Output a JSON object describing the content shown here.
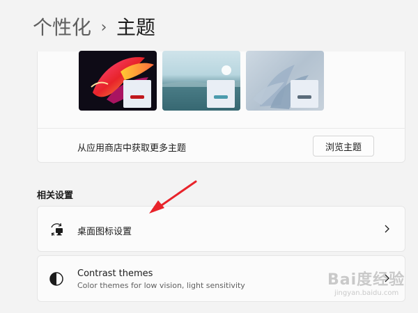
{
  "header": {
    "parent": "个性化",
    "separator": "›",
    "current": "主题"
  },
  "themes": {
    "items": [
      {
        "name": "theme-glow",
        "accent": "#c0181c"
      },
      {
        "name": "theme-captured-motion",
        "accent": "#4b9bad"
      },
      {
        "name": "theme-flow",
        "accent": "#5a6b7a"
      }
    ],
    "store_text": "从应用商店中获取更多主题",
    "browse_label": "浏览主题"
  },
  "related": {
    "section_label": "相关设置",
    "desktop_icons": {
      "title": "桌面图标设置",
      "icon": "desktop-icon-settings-icon"
    },
    "contrast": {
      "title": "Contrast themes",
      "subtitle": "Color themes for low vision, light sensitivity",
      "icon": "contrast-icon"
    }
  },
  "annotation": {
    "color": "#e8232a"
  },
  "watermark": {
    "logo": "Bai度经验",
    "url": "jingyan.baidu.com"
  }
}
